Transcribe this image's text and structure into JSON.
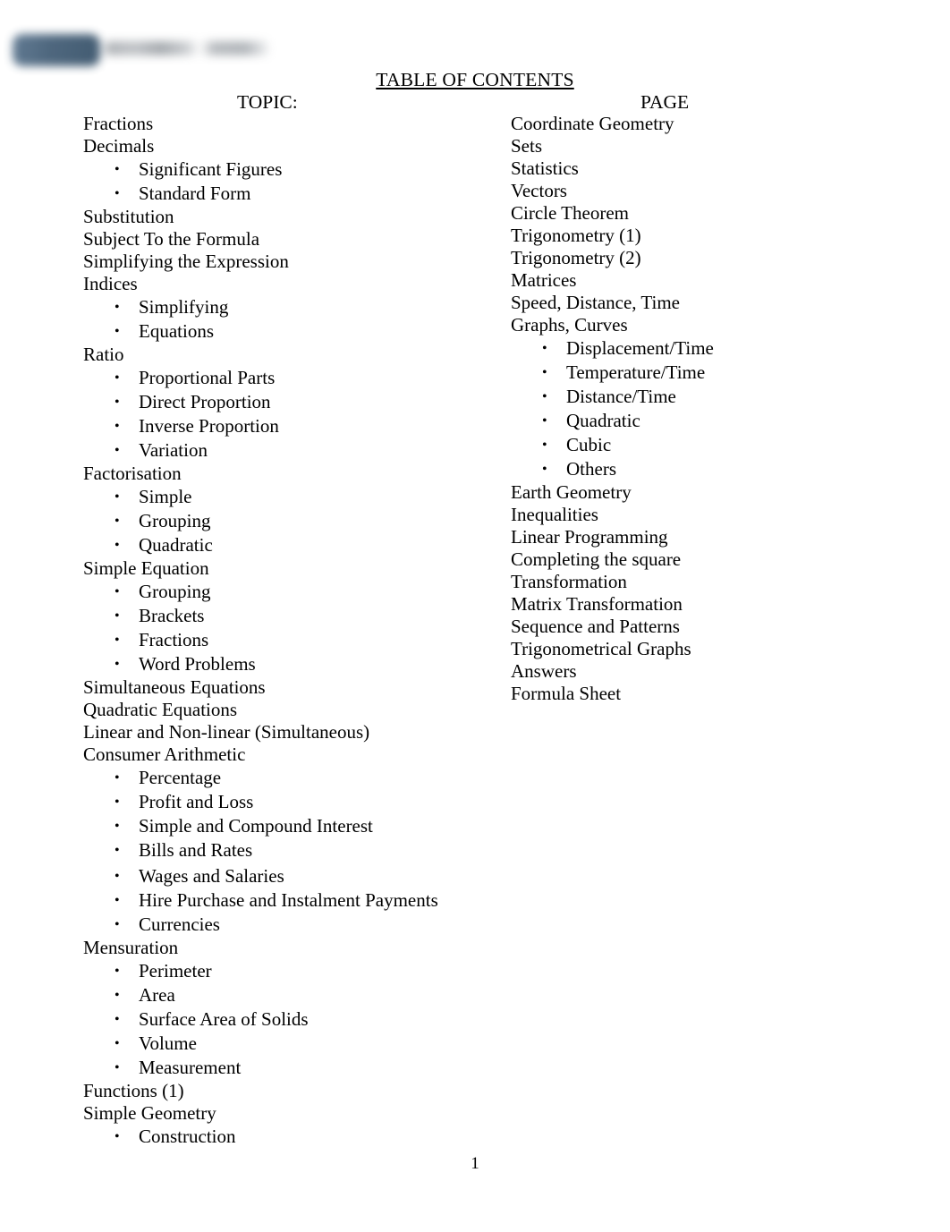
{
  "document": {
    "title": "TABLE OF CONTENTS",
    "topic_header": "TOPIC:",
    "page_header": "PAGE",
    "page_number": "1"
  },
  "logo": {
    "badge_color": "#3f5a73",
    "wordmark_color": "#9aa0a6",
    "state": "blurred"
  },
  "left_column": [
    {
      "label": "Fractions",
      "level": 0
    },
    {
      "label": "Decimals",
      "level": 0
    },
    {
      "label": "Significant Figures",
      "level": 1
    },
    {
      "label": "Standard Form",
      "level": 1
    },
    {
      "label": "Substitution",
      "level": 0
    },
    {
      "label": "Subject To the Formula",
      "level": 0
    },
    {
      "label": "Simplifying the Expression",
      "level": 0
    },
    {
      "label": "Indices",
      "level": 0
    },
    {
      "label": "Simplifying",
      "level": 1
    },
    {
      "label": "Equations",
      "level": 1
    },
    {
      "label": "Ratio",
      "level": 0
    },
    {
      "label": "Proportional Parts",
      "level": 1
    },
    {
      "label": "Direct Proportion",
      "level": 1
    },
    {
      "label": "Inverse Proportion",
      "level": 1
    },
    {
      "label": "Variation",
      "level": 1
    },
    {
      "label": "Factorisation",
      "level": 0
    },
    {
      "label": "Simple",
      "level": 1
    },
    {
      "label": "Grouping",
      "level": 1
    },
    {
      "label": "Quadratic",
      "level": 1
    },
    {
      "label": "Simple Equation",
      "level": 0
    },
    {
      "label": "Grouping",
      "level": 1
    },
    {
      "label": "Brackets",
      "level": 1
    },
    {
      "label": "Fractions",
      "level": 1
    },
    {
      "label": "Word Problems",
      "level": 1
    },
    {
      "label": "Simultaneous Equations",
      "level": 0
    },
    {
      "label": "Quadratic Equations",
      "level": 0
    },
    {
      "label": "Linear and Non-linear (Simultaneous)",
      "level": 0
    },
    {
      "label": "Consumer Arithmetic",
      "level": 0
    },
    {
      "label": "Percentage",
      "level": 1
    },
    {
      "label": "Profit and Loss",
      "level": 1
    },
    {
      "label": "Simple and Compound Interest",
      "level": 1
    },
    {
      "label": "Bills and Rates",
      "level": 1
    },
    {
      "label": "Wages and Salaries",
      "level": 1,
      "extra_gap": true
    },
    {
      "label": "Hire Purchase and Instalment Payments",
      "level": 1
    },
    {
      "label": "Currencies",
      "level": 1
    },
    {
      "label": "Mensuration",
      "level": 0
    },
    {
      "label": "Perimeter",
      "level": 1
    },
    {
      "label": "Area",
      "level": 1
    },
    {
      "label": "Surface Area of Solids",
      "level": 1
    },
    {
      "label": "Volume",
      "level": 1
    },
    {
      "label": "Measurement",
      "level": 1
    },
    {
      "label": "Functions (1)",
      "level": 0
    },
    {
      "label": "Simple Geometry",
      "level": 0
    },
    {
      "label": "Construction",
      "level": 1
    }
  ],
  "right_column": [
    {
      "label": "Coordinate Geometry",
      "level": 0
    },
    {
      "label": "Sets",
      "level": 0
    },
    {
      "label": "Statistics",
      "level": 0
    },
    {
      "label": "Vectors",
      "level": 0
    },
    {
      "label": "Circle Theorem",
      "level": 0
    },
    {
      "label": "Trigonometry (1)",
      "level": 0
    },
    {
      "label": "Trigonometry (2)",
      "level": 0
    },
    {
      "label": "Matrices",
      "level": 0
    },
    {
      "label": "Speed, Distance, Time",
      "level": 0
    },
    {
      "label": "Graphs, Curves",
      "level": 0
    },
    {
      "label": "Displacement/Time",
      "level": 1
    },
    {
      "label": "Temperature/Time",
      "level": 1
    },
    {
      "label": "Distance/Time",
      "level": 1
    },
    {
      "label": "Quadratic",
      "level": 1
    },
    {
      "label": "Cubic",
      "level": 1
    },
    {
      "label": "Others",
      "level": 1
    },
    {
      "label": "Earth Geometry",
      "level": 0
    },
    {
      "label": "Inequalities",
      "level": 0
    },
    {
      "label": "Linear Programming",
      "level": 0
    },
    {
      "label": "Completing the square",
      "level": 0
    },
    {
      "label": "Transformation",
      "level": 0
    },
    {
      "label": "Matrix Transformation",
      "level": 0
    },
    {
      "label": "Sequence and Patterns",
      "level": 0
    },
    {
      "label": "Trigonometrical Graphs",
      "level": 0
    },
    {
      "label": "Answers",
      "level": 0
    },
    {
      "label": "Formula Sheet",
      "level": 0
    }
  ],
  "icons": {
    "bullet": "•"
  }
}
